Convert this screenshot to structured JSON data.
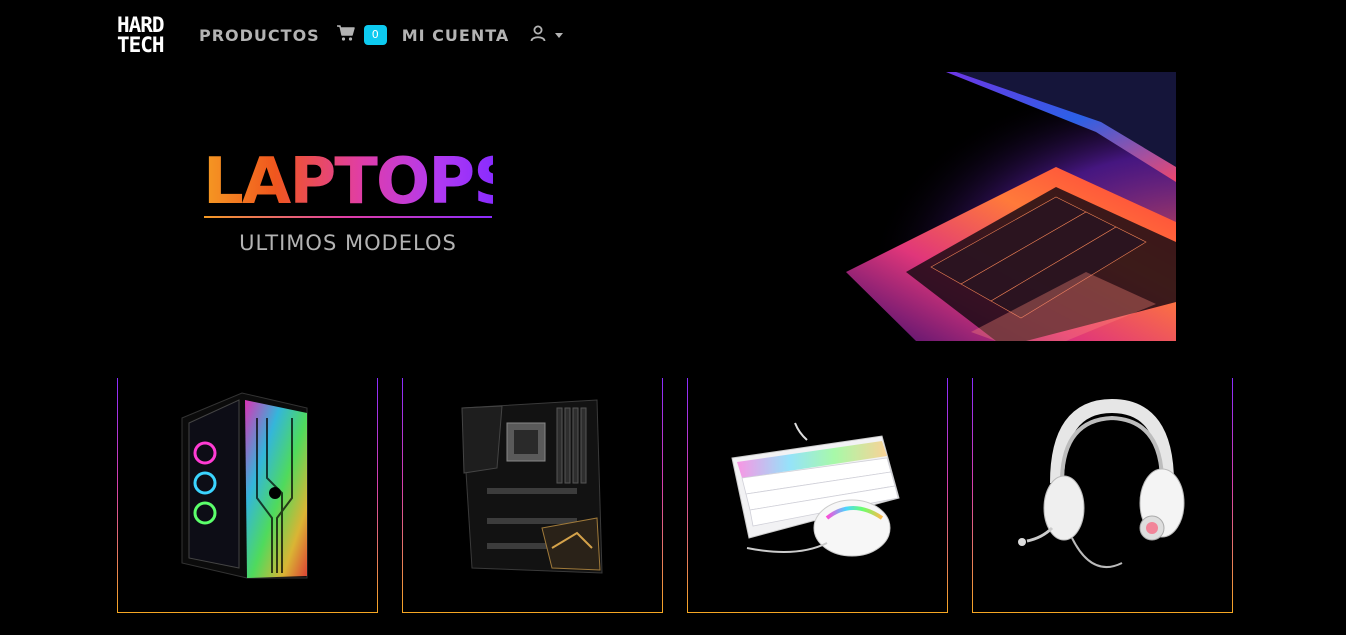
{
  "brand": {
    "logo_line1": "HARD",
    "logo_line2": "TECH"
  },
  "nav": {
    "productos": "PRODUCTOS",
    "cart_icon": "cart-icon",
    "cart_count": "0",
    "mi_cuenta": "MI CUENTA",
    "user_icon": "user-icon"
  },
  "hero": {
    "title": "LAPTOPS",
    "subtitle": "ULTIMOS MODELOS"
  },
  "products": [
    {
      "icon": "pc-case-image"
    },
    {
      "icon": "motherboard-image"
    },
    {
      "icon": "keyboard-mouse-image"
    },
    {
      "icon": "headset-image"
    }
  ],
  "colors": {
    "accent": "#0dcaf0",
    "orange": "#f5a623",
    "purple": "#8a2cff",
    "nav_text": "#b3b3b3"
  }
}
